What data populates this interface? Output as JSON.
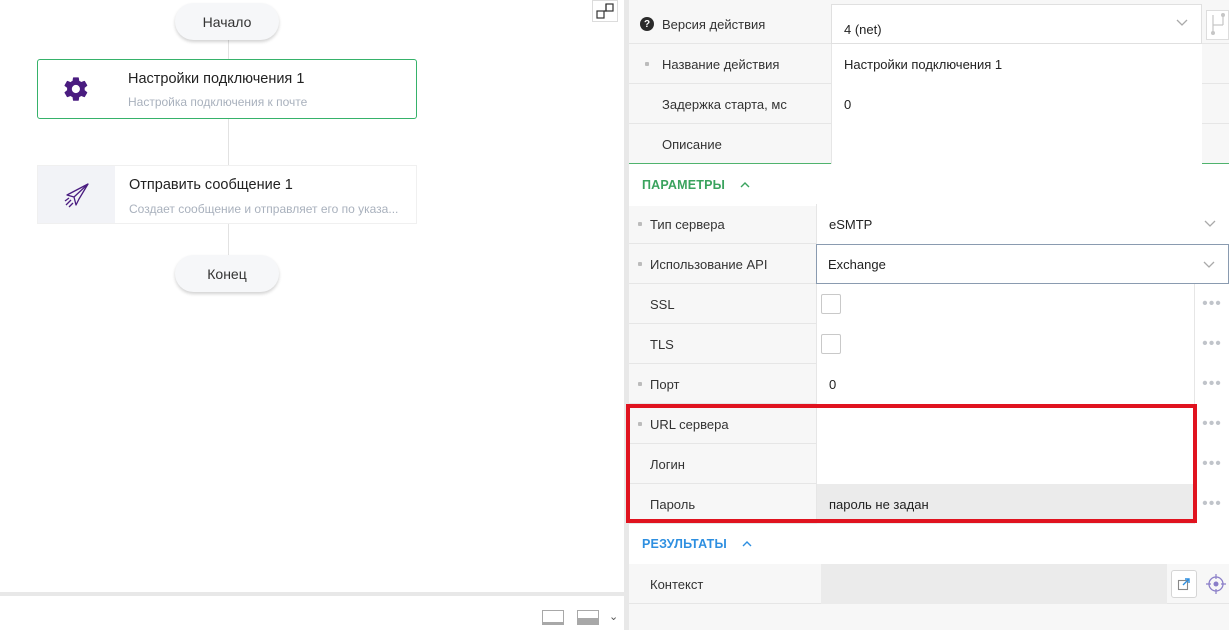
{
  "canvas": {
    "start_label": "Начало",
    "end_label": "Конец",
    "nodes": [
      {
        "title": "Настройки подключения 1",
        "subtitle": "Настройка подключения к почте",
        "icon": "gear-icon"
      },
      {
        "title": "Отправить сообщение 1",
        "subtitle": "Создает сообщение и отправляет его по указа...",
        "icon": "paper-plane-icon"
      }
    ]
  },
  "properties": {
    "version_label": "Версия действия",
    "version_value": "4 (net)",
    "name_label": "Название действия",
    "name_value": "Настройки подключения 1",
    "delay_label": "Задержка старта, мс",
    "delay_value": "0",
    "description_label": "Описание",
    "description_value": ""
  },
  "parameters": {
    "title": "ПАРАМЕТРЫ",
    "title_color": "#3aa35e",
    "server_type_label": "Тип сервера",
    "server_type_value": "eSMTP",
    "api_usage_label": "Использование API",
    "api_usage_value": "Exchange",
    "ssl_label": "SSL",
    "tls_label": "TLS",
    "port_label": "Порт",
    "port_value": "0",
    "server_url_label": "URL сервера",
    "server_url_value": "",
    "login_label": "Логин",
    "login_value": "",
    "password_label": "Пароль",
    "password_value": "пароль не задан"
  },
  "results": {
    "title": "РЕЗУЛЬТАТЫ",
    "title_color": "#2e8fe0",
    "context_label": "Контекст"
  },
  "colors": {
    "accent_green": "#36b26a",
    "highlight_red": "#e0131f",
    "node_icon_purple": "#4a1c80"
  }
}
